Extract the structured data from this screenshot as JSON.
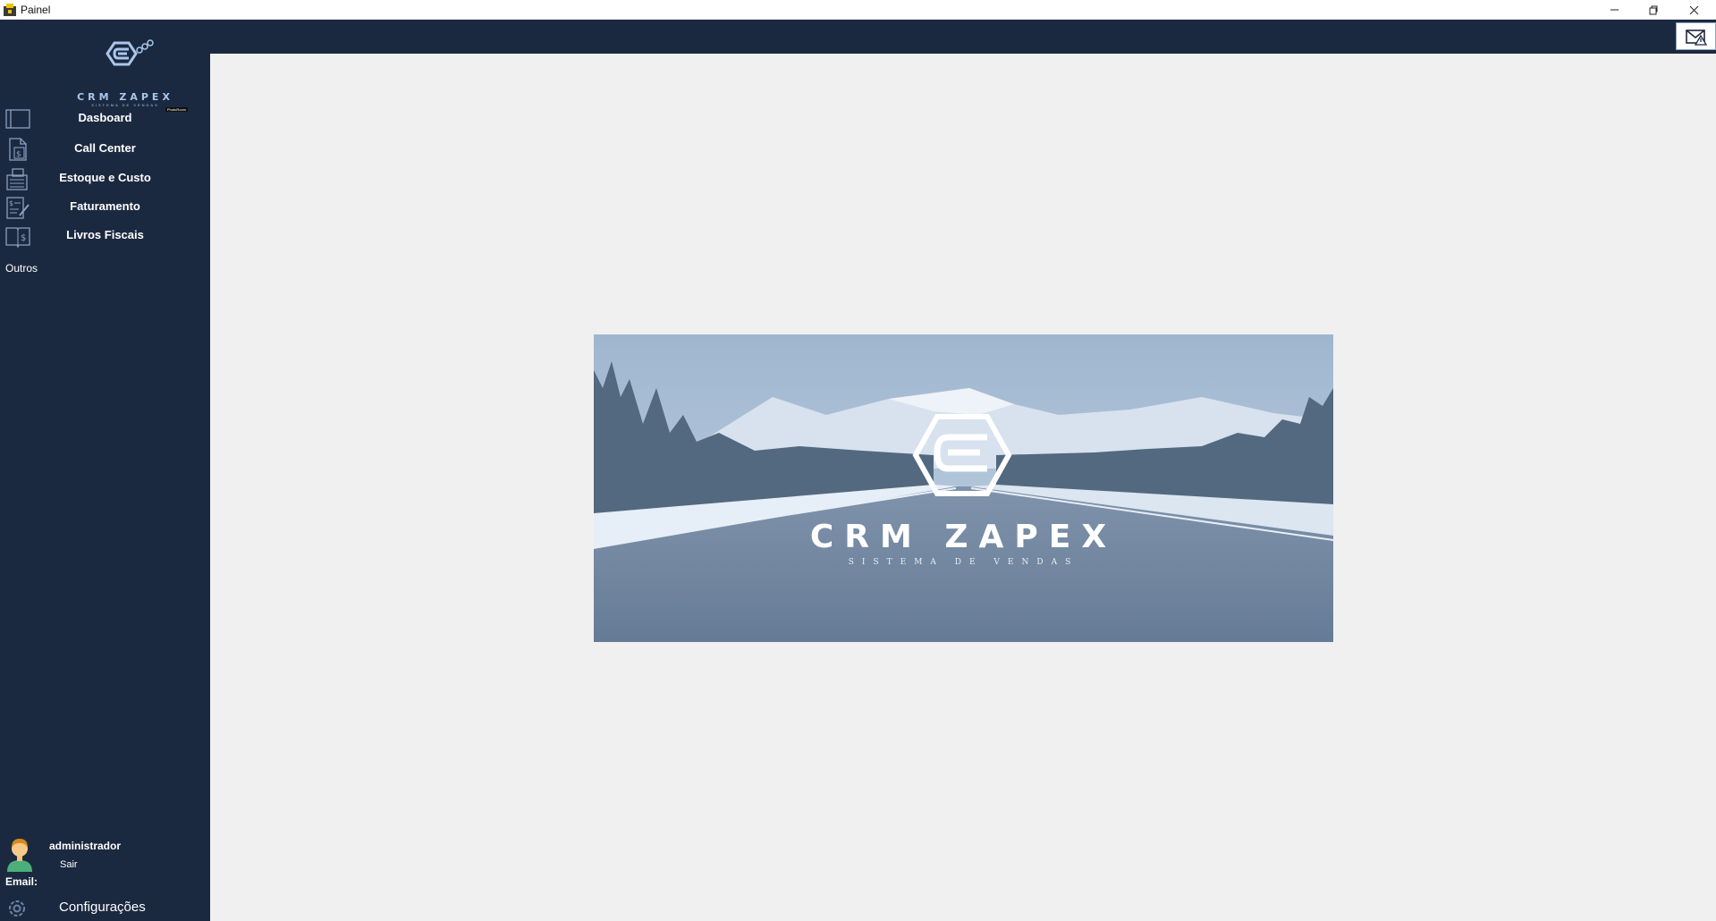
{
  "window": {
    "title": "Painel"
  },
  "sidebar": {
    "logo": {
      "brand": "CRM ZAPEX",
      "tagline": "SISTEMA DE VENDAS",
      "credit": "PhotoRoom"
    },
    "items": [
      {
        "label": "Dasboard",
        "icon": "dashboard-icon"
      },
      {
        "label": "Call Center",
        "icon": "document-dollar-icon"
      },
      {
        "label": "Estoque e Custo",
        "icon": "stock-cost-icon"
      },
      {
        "label": "Faturamento",
        "icon": "invoice-edit-icon"
      },
      {
        "label": "Livros Fiscais",
        "icon": "fiscal-book-icon"
      }
    ],
    "section_label": "Outros",
    "user": {
      "name": "administrador",
      "logout_label": "Sair",
      "email_label": "Email:"
    },
    "settings_label": "Configurações"
  },
  "banner": {
    "brand": "CRM ZAPEX",
    "tagline": "SISTEMA DE VENDAS"
  },
  "colors": {
    "sidebar_bg": "#1b2940",
    "content_bg": "#f0f0f0",
    "accent": "#a9c7ea"
  }
}
